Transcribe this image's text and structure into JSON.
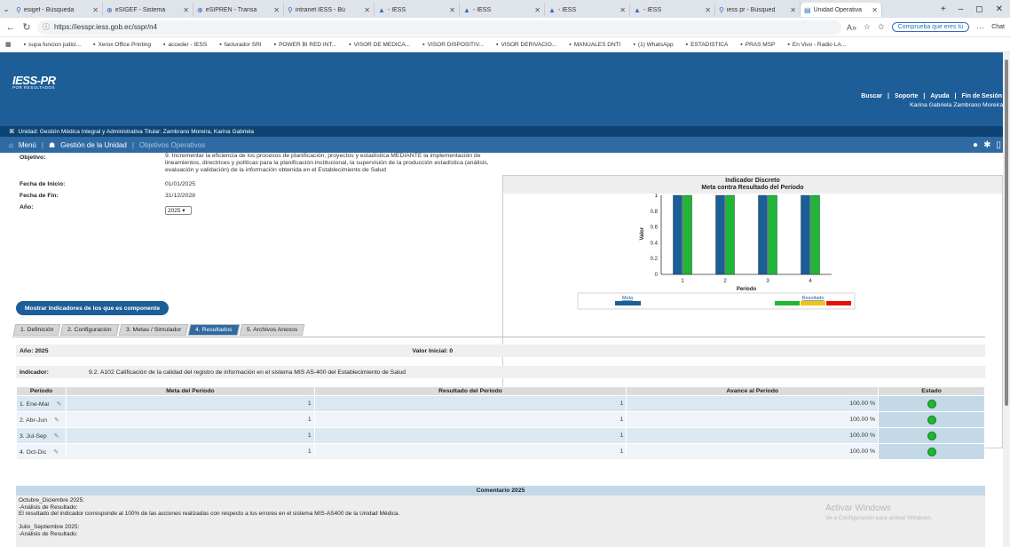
{
  "browser": {
    "tabs": [
      {
        "label": "esigef - Búsqueda",
        "icon": "search-icon"
      },
      {
        "label": "eSIGEF - Sistema",
        "icon": "globe-icon"
      },
      {
        "label": "eSIPREN - Transa",
        "icon": "globe-icon"
      },
      {
        "label": "intranet IESS - Bú",
        "icon": "search-icon"
      },
      {
        "label": "- IESS",
        "icon": "iess-icon"
      },
      {
        "label": "- IESS",
        "icon": "iess-icon"
      },
      {
        "label": "- IESS",
        "icon": "iess-icon"
      },
      {
        "label": "- IESS",
        "icon": "iess-icon"
      },
      {
        "label": "iess pr - Búsqued",
        "icon": "search-icon"
      },
      {
        "label": "Unidad Operativa",
        "icon": "page-icon"
      }
    ],
    "url": "https://iesspr.iess.gob.ec/sspr/n4",
    "copilot_label": "Comprueba que eres tú",
    "chat_label": "Chat",
    "bookmarks": [
      "supa funcion judici...",
      "Xerox Office Printing",
      "acceder - IESS",
      "facturador SRI",
      "POWER BI RED INT...",
      "VISOR DE MEDICA...",
      "VISOR DISPOSITIV...",
      "VISOR DERIVACIO...",
      "MANUALES DNTI",
      "(1) WhatsApp",
      "ESTADISTICA",
      "PRAS MSP",
      "En Vivo - Radio LA..."
    ]
  },
  "header": {
    "logo": "IESS-PR",
    "logo_sub": "POR RESULTADOS",
    "links": [
      "Buscar",
      "Soporte",
      "Ayuda",
      "Fin de Sesión"
    ],
    "user": "Karina Gabriela Zambrano Moreira.",
    "unit": "Unidad: Gestión Médica Integral y Administrativa  Titular: Zambrano Moreira, Karina Gabriela"
  },
  "menu": {
    "home": "Menú",
    "gestion": "Gestión de la Unidad",
    "current": "Objetivos Operativos"
  },
  "form": {
    "objetivo_label": "Objetivo:",
    "objetivo_text": "9. Incrementar la eficiencia de los procesos de planificación, proyectos y estadística MEDIANTE la implementación de lineamientos, directrices y políticas para la planificación institucional, la supervisión de la producción estadística (análisis, evaluación y validación) de la información obtenida en el Establecimiento de Salud",
    "inicio_label": "Fecha de Inicio:",
    "inicio_val": "01/01/2025",
    "fin_label": "Fecha de Fin:",
    "fin_val": "31/12/2028",
    "anio_label": "Año:",
    "anio_val": "2025"
  },
  "chart_data": {
    "type": "bar",
    "title": "Indicador Discreto",
    "subtitle": "Meta contra Resultado del Período",
    "xlabel": "Período",
    "ylabel": "Valor",
    "categories": [
      "1",
      "2",
      "3",
      "4"
    ],
    "ylim": [
      0,
      1
    ],
    "yticks": [
      "0",
      "0.2",
      "0.4",
      "0.6",
      "0.8",
      "1"
    ],
    "series": [
      {
        "name": "Meta",
        "values": [
          1,
          1,
          1,
          1
        ],
        "color": "#1a5f96"
      },
      {
        "name": "Resultado",
        "values": [
          1,
          1,
          1,
          1
        ],
        "color": "#1fb735"
      }
    ],
    "legend": {
      "meta_label": "Meta",
      "resultado_label": "Resultado",
      "resultado_colors": [
        "#1fb735",
        "#f2c40f",
        "#e81010"
      ]
    }
  },
  "mostrar_button": "Mostrar Indicadores de los que es componente",
  "tabs": [
    "1. Definición",
    "2. Configuración",
    "3. Metas / Simulador",
    "4. Resultados",
    "5. Archivos Anexos"
  ],
  "resultados": {
    "anio": "Año: 2025",
    "valor_inicial": "Valor Inicial: 0",
    "indicador_label": "Indicador:",
    "indicador_text": "9.2. A102 Calificación de la calidad del registro de información en el sistema MIS AS-400 del Establecimiento de Salud",
    "columns": [
      "Período",
      "Meta del Período",
      "Resultado del Período",
      "Avance al Período",
      "Estado"
    ],
    "rows": [
      {
        "periodo": "1. Ene-Mar",
        "meta": "1",
        "resultado": "1",
        "avance": "100.00 %"
      },
      {
        "periodo": "2. Abr-Jun",
        "meta": "1",
        "resultado": "1",
        "avance": "100.00 %"
      },
      {
        "periodo": "3. Jul-Sep",
        "meta": "1",
        "resultado": "1",
        "avance": "100.00 %"
      },
      {
        "periodo": "4. Oct-Dic",
        "meta": "1",
        "resultado": "1",
        "avance": "100.00 %"
      }
    ]
  },
  "comentario": {
    "title": "Comentario 2025",
    "lines": [
      "Octubre_Diciembre 2025:",
      "-Análisis de Resultado:",
      "El resultado del indicador corresponde al 100% de las acciones realizadas con respecto a los errores en el sistema MIS-AS400 de la Unidad Médica.",
      "",
      "Julio_Septiembre 2025:",
      "-Análisis de Resultado:"
    ]
  },
  "watermark": {
    "title": "Activar Windows",
    "sub": "Ve a Configuración para activar Windows."
  }
}
